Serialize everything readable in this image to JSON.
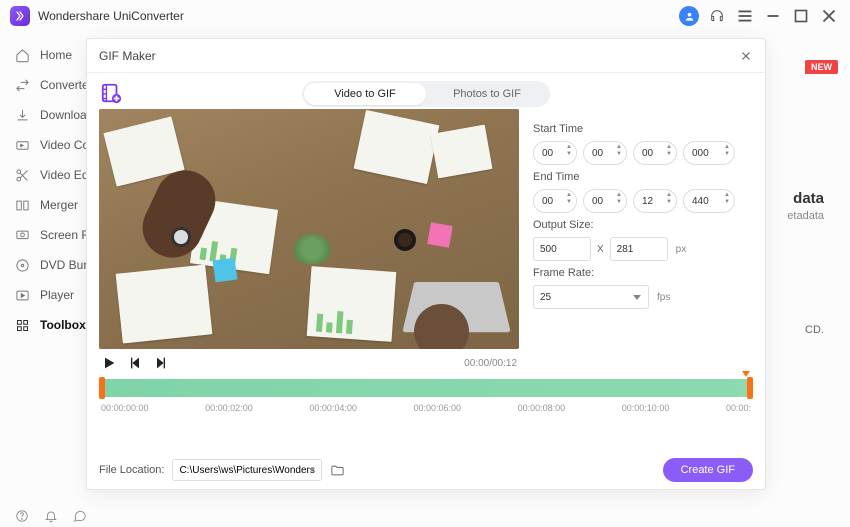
{
  "app": {
    "title": "Wondershare UniConverter"
  },
  "sidebar": {
    "items": [
      {
        "label": "Home"
      },
      {
        "label": "Converter"
      },
      {
        "label": "Downloader"
      },
      {
        "label": "Video Compressor"
      },
      {
        "label": "Video Editor"
      },
      {
        "label": "Merger"
      },
      {
        "label": "Screen Recorder"
      },
      {
        "label": "DVD Burner"
      },
      {
        "label": "Player"
      },
      {
        "label": "Toolbox"
      }
    ]
  },
  "content_bg": {
    "new_badge": "NEW",
    "hint_title": "data",
    "hint_sub": "etadata",
    "hint_line": "CD."
  },
  "modal": {
    "title": "GIF Maker",
    "tabs": {
      "video": "Video to GIF",
      "photos": "Photos to GIF"
    },
    "player": {
      "time": "00:00/00:12"
    },
    "params": {
      "start_label": "Start Time",
      "start": {
        "h": "00",
        "m": "00",
        "s": "00",
        "ms": "000"
      },
      "end_label": "End Time",
      "end": {
        "h": "00",
        "m": "00",
        "s": "12",
        "ms": "440"
      },
      "size_label": "Output Size:",
      "size": {
        "w": "500",
        "h": "281",
        "unit": "px"
      },
      "fps_label": "Frame Rate:",
      "fps_value": "25",
      "fps_unit": "fps"
    },
    "timeline": {
      "ticks": [
        "00:00:00:00",
        "00:00:02:00",
        "00:00:04:00",
        "00:00:06:00",
        "00:00:08:00",
        "00:00:10:00",
        "00:00:"
      ]
    },
    "footer": {
      "location_label": "File Location:",
      "location_value": "C:\\Users\\ws\\Pictures\\Wonders",
      "create_label": "Create GIF"
    }
  }
}
